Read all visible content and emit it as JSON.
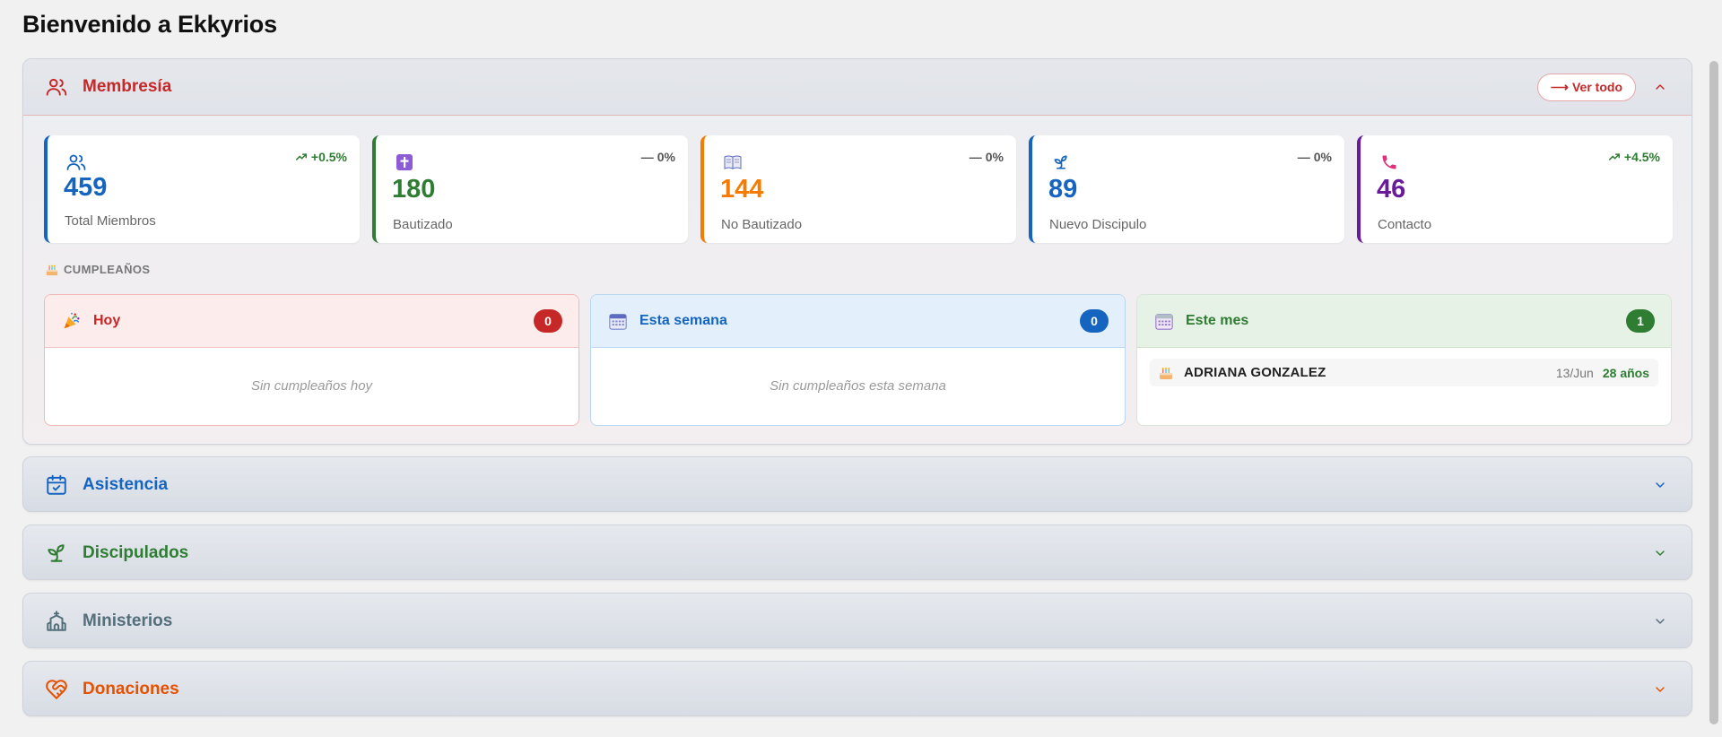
{
  "page": {
    "title": "Bienvenido a Ekkyrios"
  },
  "membresia": {
    "title": "Membresía",
    "view_all": "Ver todo",
    "view_all_arrow": "⟶",
    "stats": [
      {
        "value": "459",
        "label": "Total Miembros",
        "trend": "+0.5%",
        "trend_dir": "up",
        "color": "#1565c0",
        "icon": "users-icon"
      },
      {
        "value": "180",
        "label": "Bautizado",
        "trend": "0%",
        "trend_dir": "flat",
        "color": "#2e7d32",
        "icon": "cross-icon"
      },
      {
        "value": "144",
        "label": "No Bautizado",
        "trend": "0%",
        "trend_dir": "flat",
        "color": "#f57c00",
        "icon": "book-icon"
      },
      {
        "value": "89",
        "label": "Nuevo Discipulo",
        "trend": "0%",
        "trend_dir": "flat",
        "color": "#1565c0",
        "icon": "sprout-icon"
      },
      {
        "value": "46",
        "label": "Contacto",
        "trend": "+4.5%",
        "trend_dir": "up",
        "color": "#6a1b9a",
        "icon": "phone-icon"
      }
    ],
    "birthdays": {
      "heading": "CUMPLEAÑOS",
      "today": {
        "title": "Hoy",
        "count": "0",
        "empty": "Sin cumpleaños hoy",
        "color": "#c62828"
      },
      "week": {
        "title": "Esta semana",
        "count": "0",
        "empty": "Sin cumpleaños esta semana",
        "color": "#1565c0"
      },
      "month": {
        "title": "Este mes",
        "count": "1",
        "color": "#2e7d32",
        "items": [
          {
            "name": "ADRIANA GONZALEZ",
            "date": "13/Jun",
            "age": "28 años"
          }
        ]
      }
    }
  },
  "sections": [
    {
      "title": "Asistencia",
      "color": "#1565c0",
      "icon": "calendar-check-icon"
    },
    {
      "title": "Discipulados",
      "color": "#2e7d32",
      "icon": "sprout-icon"
    },
    {
      "title": "Ministerios",
      "color": "#546e7a",
      "icon": "church-icon"
    },
    {
      "title": "Donaciones",
      "color": "#e65100",
      "icon": "heart-handshake-icon"
    }
  ]
}
